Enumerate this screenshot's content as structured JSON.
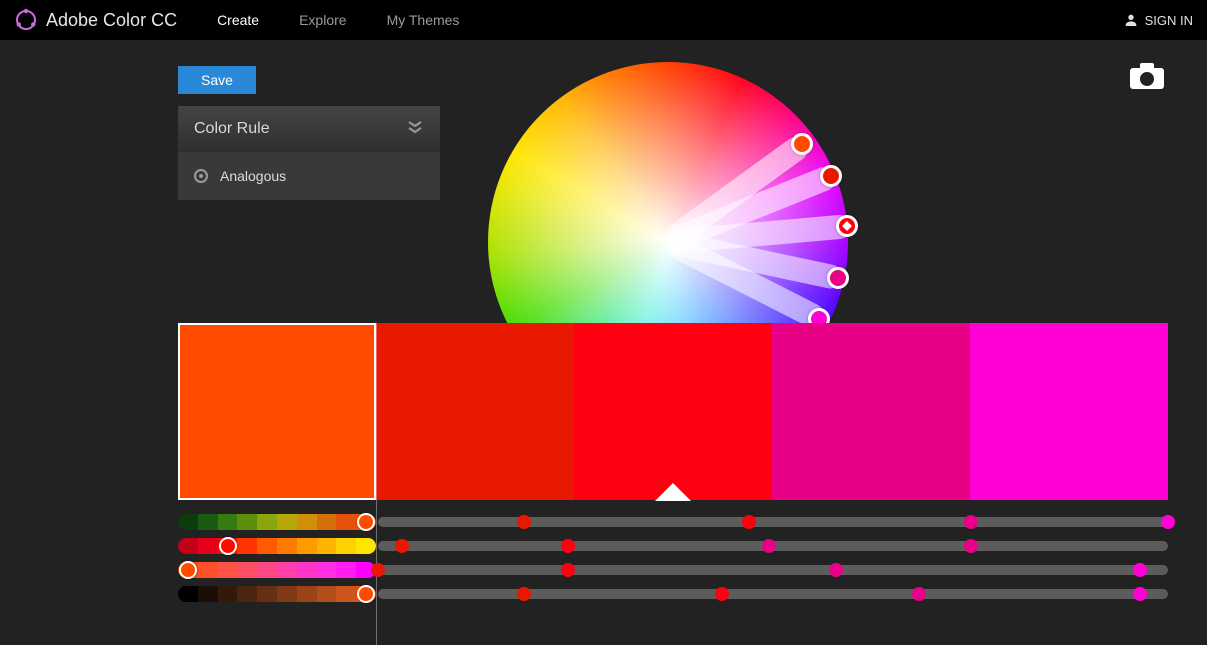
{
  "header": {
    "brand": "Adobe Color CC",
    "nav": {
      "create": "Create",
      "explore": "Explore",
      "mythemes": "My Themes"
    },
    "signin": "SIGN IN"
  },
  "actions": {
    "save": "Save"
  },
  "colorRule": {
    "title": "Color Rule",
    "selected": "Analogous"
  },
  "palette": {
    "swatches": [
      {
        "hex": "#FF4B00"
      },
      {
        "hex": "#E81900"
      },
      {
        "hex": "#FF0011"
      },
      {
        "hex": "#E80087"
      },
      {
        "hex": "#FF00D5"
      }
    ],
    "activeIndex": 0,
    "baseIndex": 2
  },
  "wheel": {
    "handles": [
      {
        "angle": -36,
        "radius": 166,
        "color": "#FF4B00"
      },
      {
        "angle": -22,
        "radius": 176,
        "color": "#E81900"
      },
      {
        "angle": -5,
        "radius": 180,
        "color": "#FF0011",
        "diamond": true
      },
      {
        "angle": 12,
        "radius": 174,
        "color": "#E80087"
      },
      {
        "angle": 27,
        "radius": 170,
        "color": "#FF00D5"
      }
    ]
  },
  "sliders": {
    "rows": [
      {
        "segments": [
          "#0e3b0e",
          "#1b5a12",
          "#357b0f",
          "#5c8f0a",
          "#8aa60d",
          "#b7a706",
          "#cf8f08",
          "#d36f06",
          "#e5520a",
          "#ff4b00"
        ],
        "activeSegment": 9,
        "knobs": [
          {
            "pct": 0.185,
            "color": "#E81900"
          },
          {
            "pct": 0.47,
            "color": "#FF0011"
          },
          {
            "pct": 0.75,
            "color": "#E80087"
          },
          {
            "pct": 1.0,
            "color": "#FF00D5"
          }
        ]
      },
      {
        "segments": [
          "#c2001a",
          "#e8001a",
          "#ff0a00",
          "#ff3500",
          "#ff5a00",
          "#ff7a00",
          "#ff9a00",
          "#ffb400",
          "#ffd100",
          "#ffe600"
        ],
        "activeSegment": 2,
        "knobs": [
          {
            "pct": 0.03,
            "color": "#E81900"
          },
          {
            "pct": 0.24,
            "color": "#FF0011"
          },
          {
            "pct": 0.495,
            "color": "#E80087"
          },
          {
            "pct": 0.75,
            "color": "#E80087"
          }
        ]
      },
      {
        "segments": [
          "#ff4b00",
          "#ff5128",
          "#ff5445",
          "#ff4f64",
          "#ff4987",
          "#ff3faa",
          "#ff35ca",
          "#ff2ee2",
          "#ff1df0",
          "#ff00ff"
        ],
        "activeSegment": 0,
        "knobs": [
          {
            "pct": 0.0,
            "color": "#E81900"
          },
          {
            "pct": 0.24,
            "color": "#FF0011"
          },
          {
            "pct": 0.58,
            "color": "#E80087"
          },
          {
            "pct": 0.965,
            "color": "#FF00D5"
          }
        ]
      },
      {
        "segments": [
          "#000000",
          "#1a0e06",
          "#33190a",
          "#4d240d",
          "#662f10",
          "#803914",
          "#994317",
          "#b34d1a",
          "#cc571d",
          "#ff4b00"
        ],
        "activeSegment": 9,
        "knobs": [
          {
            "pct": 0.185,
            "color": "#E81900"
          },
          {
            "pct": 0.435,
            "color": "#FF0011"
          },
          {
            "pct": 0.685,
            "color": "#E80087"
          },
          {
            "pct": 0.965,
            "color": "#FF00D5"
          }
        ]
      }
    ]
  }
}
